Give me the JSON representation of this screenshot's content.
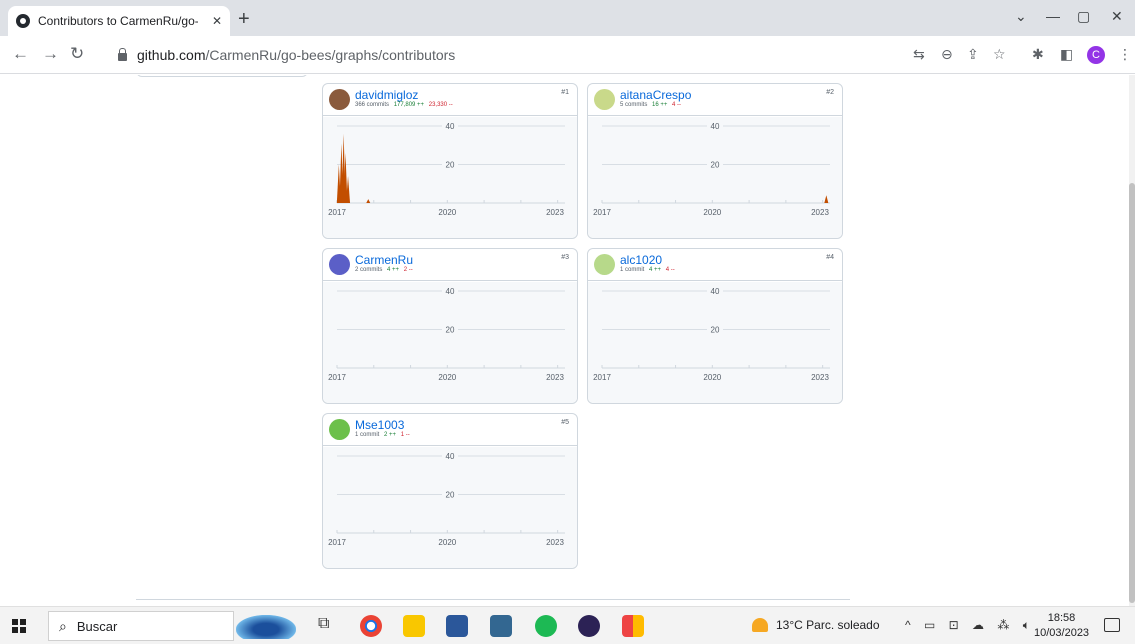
{
  "browser": {
    "tab_title": "Contributors to CarmenRu/go-be",
    "tab_close": "✕",
    "new_tab": "+",
    "url_host": "github.com",
    "url_path": "/CarmenRu/go-bees/graphs/contributors",
    "profile_initial": "C",
    "icons": [
      "translate-icon",
      "zoom-icon",
      "share-icon",
      "bookmark-star-icon",
      "extensions-icon",
      "side-panel-icon",
      "more-icon"
    ]
  },
  "contributors": [
    {
      "name": "davidmigloz",
      "commits": "366 commits",
      "additions": "177,809 ++",
      "deletions": "23,330 --",
      "rank": "#1",
      "avatar_color": "#8a5a3c"
    },
    {
      "name": "aitanaCrespo",
      "commits": "5 commits",
      "additions": "16 ++",
      "deletions": "4 --",
      "rank": "#2",
      "avatar_color": "#c9d98a"
    },
    {
      "name": "CarmenRu",
      "commits": "2 commits",
      "additions": "4 ++",
      "deletions": "2 --",
      "rank": "#3",
      "avatar_color": "#5b5fc7"
    },
    {
      "name": "alc1020",
      "commits": "1 commit",
      "additions": "4 ++",
      "deletions": "4 --",
      "rank": "#4",
      "avatar_color": "#b7d98a"
    },
    {
      "name": "Mse1003",
      "commits": "1 commit",
      "additions": "2 ++",
      "deletions": "1 --",
      "rank": "#5",
      "avatar_color": "#6cc04a"
    }
  ],
  "chart_data": [
    {
      "type": "area",
      "contributor": "davidmigloz",
      "ylim": [
        0,
        40
      ],
      "y_ticks": [
        "40",
        "20"
      ],
      "x_ticks": [
        "2017",
        "2020",
        "2023"
      ],
      "color": "#c24e00",
      "spikes": [
        [
          2017.05,
          20
        ],
        [
          2017.12,
          31
        ],
        [
          2017.18,
          36
        ],
        [
          2017.23,
          26
        ],
        [
          2017.3,
          14
        ],
        [
          2017.85,
          2
        ]
      ]
    },
    {
      "type": "area",
      "contributor": "aitanaCrespo",
      "ylim": [
        0,
        40
      ],
      "y_ticks": [
        "40",
        "20"
      ],
      "x_ticks": [
        "2017",
        "2020",
        "2023"
      ],
      "color": "#c24e00",
      "spikes": [
        [
          2023.1,
          4
        ]
      ]
    },
    {
      "type": "area",
      "contributor": "CarmenRu",
      "ylim": [
        0,
        40
      ],
      "y_ticks": [
        "40",
        "20"
      ],
      "x_ticks": [
        "2017",
        "2020",
        "2023"
      ],
      "color": "#c24e00",
      "spikes": []
    },
    {
      "type": "area",
      "contributor": "alc1020",
      "ylim": [
        0,
        40
      ],
      "y_ticks": [
        "40",
        "20"
      ],
      "x_ticks": [
        "2017",
        "2020",
        "2023"
      ],
      "color": "#c24e00",
      "spikes": []
    },
    {
      "type": "area",
      "contributor": "Mse1003",
      "ylim": [
        0,
        40
      ],
      "y_ticks": [
        "40",
        "20"
      ],
      "x_ticks": [
        "2017",
        "2020",
        "2023"
      ],
      "color": "#c24e00",
      "spikes": []
    }
  ],
  "taskbar": {
    "search_text": "Buscar",
    "weather": "13°C  Parc. soleado",
    "time": "18:58",
    "date": "10/03/2023"
  }
}
